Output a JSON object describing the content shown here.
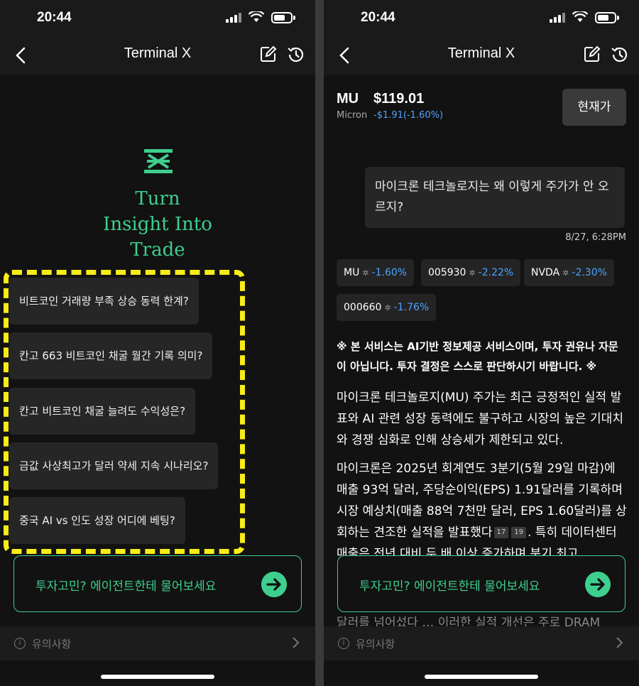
{
  "left": {
    "status": {
      "time": "20:44"
    },
    "nav": {
      "title": "Terminal X"
    },
    "tagline": [
      "Turn",
      "Insight Into",
      "Trade"
    ],
    "suggestions": [
      "비트코인 거래량 부족 상승 동력 한계?",
      "칸고 663 비트코인 채굴 월간 기록 의미?",
      "칸고 비트코인 채굴 늘려도 수익성은?",
      "금값 사상최고가 달러 약세 지속 시나리오?",
      "중국 AI vs 인도 성장 어디에 베팅?"
    ],
    "ask_placeholder": "투자고민? 에이전트한테 물어보세요",
    "notice_label": "유의사항"
  },
  "right": {
    "status": {
      "time": "20:44"
    },
    "nav": {
      "title": "Terminal X"
    },
    "ticker": {
      "symbol": "MU",
      "price": "$119.01",
      "name": "Micron",
      "change": "-$1.91(-1.60%)"
    },
    "current_price_button": "현재가",
    "question": "마이크론 테크놀로지는 왜 이렇게 주가가 안 오르지?",
    "timestamp": "8/27, 6:28PM",
    "chips": [
      {
        "symbol": "MU",
        "pct": "-1.60%"
      },
      {
        "symbol": "005930",
        "pct": "-2.22%"
      },
      {
        "symbol": "NVDA",
        "pct": "-2.30%"
      },
      {
        "symbol": "000660",
        "pct": "-1.76%"
      }
    ],
    "disclaimer": "※ 본 서비스는 AI기반 정보제공 서비스이며, 투자 권유나 자문이 아닙니다. 투자 결정은 스스로 판단하시기 바랍니다. ※",
    "answer_intro": "마이크론 테크놀로지(MU) 주가는 최근 긍정적인 실적 발표와 AI 관련 성장 동력에도 불구하고 시장의 높은 기대치와 경쟁 심화로 인해 상승세가 제한되고 있다.",
    "answer_body_a": "마이크론은 2025년 회계연도 3분기(5월 29일 마감)에 매출 93억 달러, 주당순이익(EPS) 1.91달러를 기록하며 시장 예상치(매출 88억 7천만 달러, EPS 1.60달러)를 상회하는 견조한 실적을 발표했다",
    "refs": [
      "17",
      "19"
    ],
    "answer_body_b": ". 특히 데이터센터 매출은 전년 대비 두 배 이상 증가하며 분기 최고",
    "answer_tail": "달러를 넘어섰다 … 이러한 실적 개선은 주로 DRAM",
    "ask_placeholder": "투자고민? 에이전트한테 물어보세요",
    "notice_label": "유의사항"
  },
  "icons": {
    "back": "chevron-left-icon",
    "edit": "edit-icon",
    "history": "history-icon",
    "go": "arrow-right-icon",
    "info": "info-icon",
    "logo": "terminal-x-logo-icon"
  },
  "colors": {
    "accent": "#3ecf8e",
    "negative": "#4da3ff",
    "highlight": "#f7ec17",
    "background": "#121212"
  }
}
